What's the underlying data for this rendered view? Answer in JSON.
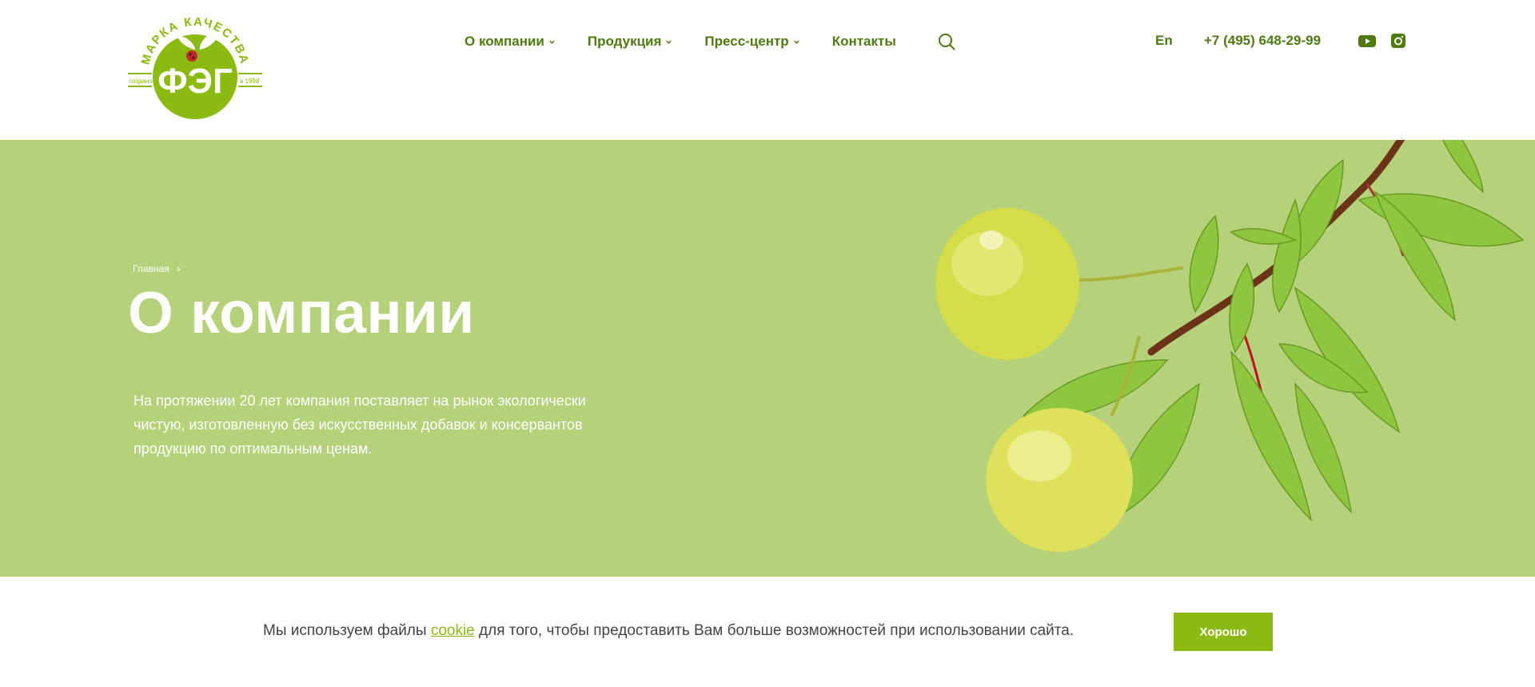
{
  "logo": {
    "arc_text": "МАРКА КАЧЕСТВА",
    "brand": "ФЭГ",
    "left_text": "создано",
    "right_text": "в 1998"
  },
  "nav": {
    "items": [
      {
        "label": "О компании",
        "has_dropdown": true
      },
      {
        "label": "Продукция",
        "has_dropdown": true
      },
      {
        "label": "Пресс-центр",
        "has_dropdown": true
      },
      {
        "label": "Контакты",
        "has_dropdown": false
      }
    ],
    "search_icon": "search-icon"
  },
  "header": {
    "lang": "En",
    "phone": "+7 (495) 648-29-99",
    "social": [
      "youtube-icon",
      "instagram-icon"
    ]
  },
  "hero": {
    "breadcrumb": [
      "Главная"
    ],
    "title": "О компании",
    "intro_lines": [
      "На протяжении 20 лет компания поставляет на рынок экологически",
      "чистую, изготовленную без искусственных добавок и консервантов",
      "продукцию по оптимальным ценам."
    ]
  },
  "cookie": {
    "text_before": "Мы используем файлы ",
    "link": "cookie",
    "text_after": " для того, чтобы предоставить Вам больше возможностей при использовании сайта.",
    "button": "Хорошо"
  },
  "colors": {
    "brand_green": "#8bbb12",
    "nav_text": "#4e7a10",
    "hero_bg": "#b5d17a",
    "white": "#ffffff"
  }
}
